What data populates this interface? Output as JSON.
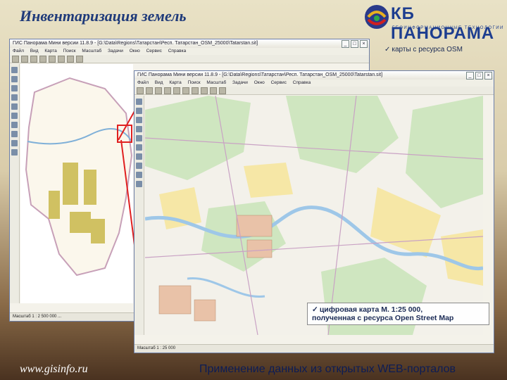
{
  "slide": {
    "title": "Инвентаризация земель",
    "footer_url": "www.gisinfo.ru",
    "footer_caption": "Применение данных из открытых WEB-порталов"
  },
  "logo": {
    "text": "КБ ПАНОРАМА",
    "subtitle": "ГЕОИНФОРМАЦИОННЫЕ ТЕХНОЛОГИИ"
  },
  "window_back": {
    "title": "ГИС Панорама Мини версии 11.8.9 - [G:\\Data\\Regions\\Татарстан\\Респ. Татарстан_OSM_25000\\Tatarstan.sit]",
    "menu": [
      "Файл",
      "Вид",
      "Карта",
      "Поиск",
      "Масштаб",
      "Задачи",
      "Окно",
      "Сервис",
      "Справка"
    ],
    "status": "Масштаб 1 : 2 500 000 ..."
  },
  "window_front": {
    "title": "ГИС Панорама Мини версии 11.8.9 - [G:\\Data\\Regions\\Татарстан\\Респ. Татарстан_OSM_25000\\Tatarstan.sit]",
    "menu": [
      "Файл",
      "Вид",
      "Карта",
      "Поиск",
      "Масштаб",
      "Задачи",
      "Окно",
      "Сервис",
      "Справка"
    ],
    "status": "Масштаб 1 : 25 000"
  },
  "annotations": {
    "osm_label": "карты с ресурса OSM",
    "digital_map_line1": "цифровая карта М. 1:25 000,",
    "digital_map_line2": "полученная с ресурса Open Street Map"
  },
  "colors": {
    "title": "#1f3a7a",
    "callout_red": "#e02020",
    "map_forest": "#cfe6c0",
    "map_field": "#f6e7a6",
    "map_water": "#9ec7e8",
    "map_urban": "#e9c2a8"
  }
}
